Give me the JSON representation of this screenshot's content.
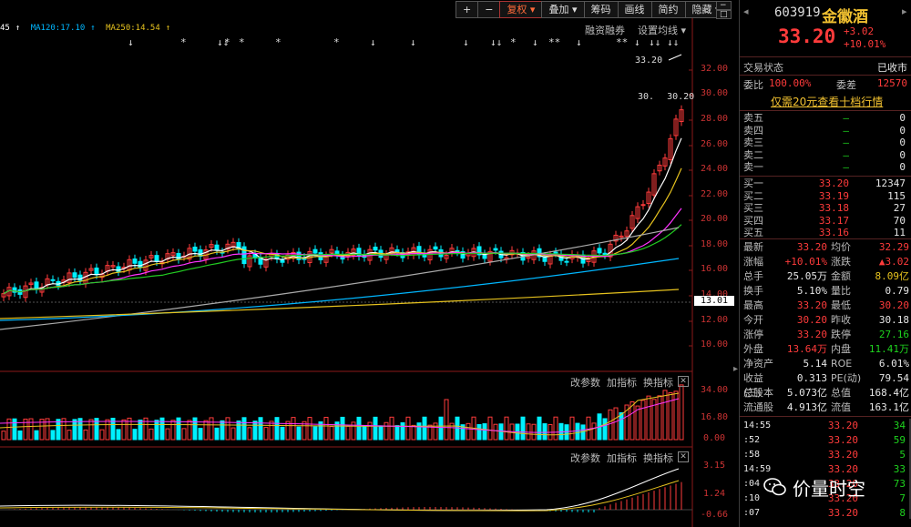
{
  "toolbar": {
    "buttons": [
      "+",
      "−",
      "复权",
      "叠加",
      "筹码",
      "画线",
      "简约",
      "隐藏"
    ],
    "side_buttons": [
      "−",
      "□"
    ]
  },
  "ma_legend": [
    {
      "text": "45",
      "color": "#ffffff"
    },
    {
      "text": "MA120:17.10",
      "color": "#00b7ff"
    },
    {
      "text": "MA250:14.54",
      "color": "#e6c21e"
    }
  ],
  "main_panel": {
    "labels": {
      "funding": "融资融券",
      "settings": "设置均线"
    },
    "high_label": "33.20",
    "low_label": "30.20",
    "price_axis": [
      "32.00",
      "30.00",
      "28.00",
      "26.00",
      "24.00",
      "22.00",
      "20.00",
      "18.00",
      "16.00",
      "14.00",
      "13.01",
      "12.00",
      "10.00"
    ]
  },
  "vol_panel": {
    "buttons": [
      "改参数",
      "加指标",
      "换指标"
    ],
    "axis": [
      "34.00",
      "16.80",
      "0.00"
    ]
  },
  "macd_panel": {
    "buttons": [
      "改参数",
      "加指标",
      "换指标"
    ],
    "axis": [
      "3.15",
      "1.24",
      "-0.66"
    ]
  },
  "quote": {
    "code": "603919",
    "name": "金徽酒",
    "price": "33.20",
    "change": "+3.02",
    "change_pct": "+10.01%",
    "status_label": "交易状态",
    "status_value": "已收市",
    "weibi_label": "委比",
    "weibi_value": "100.00%",
    "weicha_label": "委差",
    "weicha_value": "12570",
    "promo": "仅需20元查看十档行情",
    "asks": [
      {
        "label": "卖五",
        "price": "—",
        "vol": "0"
      },
      {
        "label": "卖四",
        "price": "—",
        "vol": "0"
      },
      {
        "label": "卖三",
        "price": "—",
        "vol": "0"
      },
      {
        "label": "卖二",
        "price": "—",
        "vol": "0"
      },
      {
        "label": "卖一",
        "price": "—",
        "vol": "0"
      }
    ],
    "bids": [
      {
        "label": "买一",
        "price": "33.20",
        "vol": "12347"
      },
      {
        "label": "买二",
        "price": "33.19",
        "vol": "115"
      },
      {
        "label": "买三",
        "price": "33.18",
        "vol": "27"
      },
      {
        "label": "买四",
        "price": "33.17",
        "vol": "70"
      },
      {
        "label": "买五",
        "price": "33.16",
        "vol": "11"
      }
    ],
    "stats": [
      {
        "l1": "最新",
        "v1": "33.20",
        "c1": "red",
        "l2": "均价",
        "v2": "32.29",
        "c2": "red"
      },
      {
        "l1": "涨幅",
        "v1": "+10.01%",
        "c1": "red",
        "l2": "涨跌",
        "v2": "▲3.02",
        "c2": "red"
      },
      {
        "l1": "总手",
        "v1": "25.05万",
        "c1": "white",
        "l2": "金额",
        "v2": "8.09亿",
        "c2": "yellow"
      },
      {
        "l1": "换手",
        "v1": "5.10%",
        "c1": "white",
        "l2": "量比",
        "v2": "0.79",
        "c2": "white"
      },
      {
        "l1": "最高",
        "v1": "33.20",
        "c1": "red",
        "l2": "最低",
        "v2": "30.20",
        "c2": "red"
      },
      {
        "l1": "今开",
        "v1": "30.20",
        "c1": "red",
        "l2": "昨收",
        "v2": "30.18",
        "c2": "white"
      },
      {
        "l1": "涨停",
        "v1": "33.20",
        "c1": "red",
        "l2": "跌停",
        "v2": "27.16",
        "c2": "green"
      },
      {
        "l1": "外盘",
        "v1": "13.64万",
        "c1": "red",
        "l2": "内盘",
        "v2": "11.41万",
        "c2": "green"
      },
      {
        "l1": "净资产",
        "v1": "5.14",
        "c1": "white",
        "l2": "ROE",
        "v2": "6.01%",
        "c2": "white"
      },
      {
        "l1": "收益(三)",
        "v1": "0.313",
        "c1": "white",
        "l2": "PE(动)",
        "v2": "79.54",
        "c2": "white"
      },
      {
        "l1": "总股本",
        "v1": "5.073亿",
        "c1": "white",
        "l2": "总值",
        "v2": "168.4亿",
        "c2": "white"
      },
      {
        "l1": "流通股",
        "v1": "4.913亿",
        "c1": "white",
        "l2": "流值",
        "v2": "163.1亿",
        "c2": "white"
      }
    ],
    "ticks": [
      {
        "time": "14:55",
        "price": "33.20",
        "vol": "34"
      },
      {
        "time": ":52",
        "price": "33.20",
        "vol": "59"
      },
      {
        "time": ":58",
        "price": "33.20",
        "vol": "5"
      },
      {
        "time": "14:59",
        "price": "33.20",
        "vol": "33"
      },
      {
        "time": ":04",
        "price": "33.20",
        "vol": "73"
      },
      {
        "time": ":10",
        "price": "33.20",
        "vol": "7"
      },
      {
        "time": ":07",
        "price": "33.20",
        "vol": "8"
      }
    ]
  },
  "watermark": "价量时空"
}
